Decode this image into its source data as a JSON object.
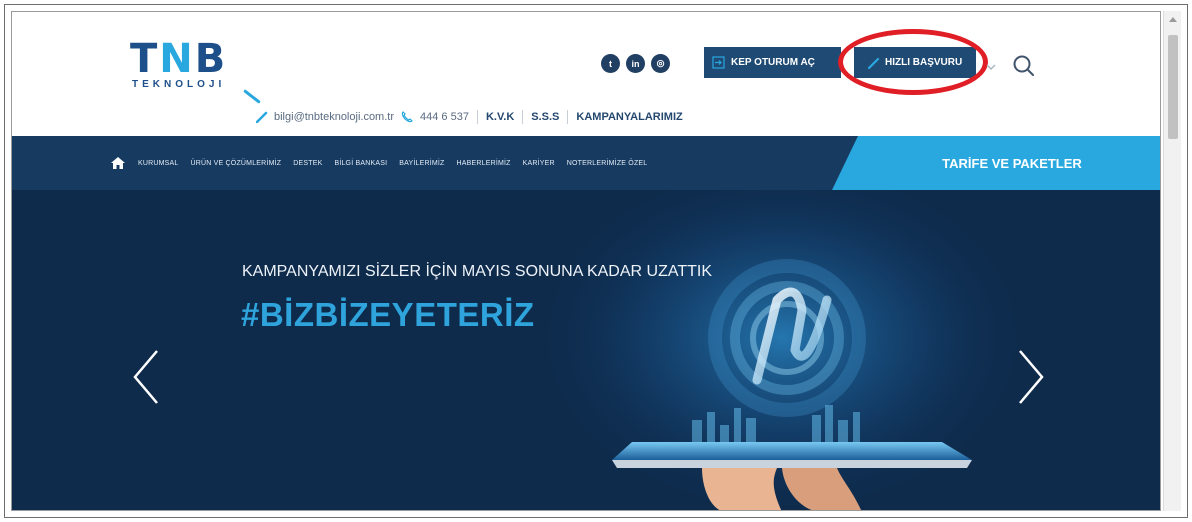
{
  "logo": {
    "main_left": "T",
    "main_accent": "N",
    "main_right": "B",
    "sub": "TEKNOLOJI"
  },
  "contact": {
    "email": "bilgi@tnbteknoloji.com.tr",
    "phone": "444 6 537",
    "links": [
      "K.V.K",
      "S.S.S",
      "KAMPANYALARIMIZ"
    ]
  },
  "socials": [
    {
      "name": "twitter-icon",
      "glyph": "t"
    },
    {
      "name": "linkedin-icon",
      "glyph": "in"
    },
    {
      "name": "instagram-icon",
      "glyph": "◎"
    }
  ],
  "header": {
    "kep_label": "KEP OTURUM AÇ",
    "hizli_label": "HIZLI BAŞVURU"
  },
  "nav": {
    "items": [
      "KURUMSAL",
      "ÜRÜN VE ÇÖZÜMLERİMİZ",
      "DESTEK",
      "BİLGİ BANKASI",
      "BAYİLERİMİZ",
      "HABERLERİMİZ",
      "KARİYER",
      "NOTERLERİMİZE ÖZEL"
    ],
    "tarife": "TARİFE VE PAKETLER"
  },
  "hero": {
    "title": "KAMPANYAMIZI SİZLER İÇİN MAYIS SONUNA KADAR UZATTIK",
    "hashtag": "#BİZBİZEYETERİZ"
  },
  "colors": {
    "navy": "#173a61",
    "accent": "#29a8df",
    "highlight": "#e01e25"
  }
}
